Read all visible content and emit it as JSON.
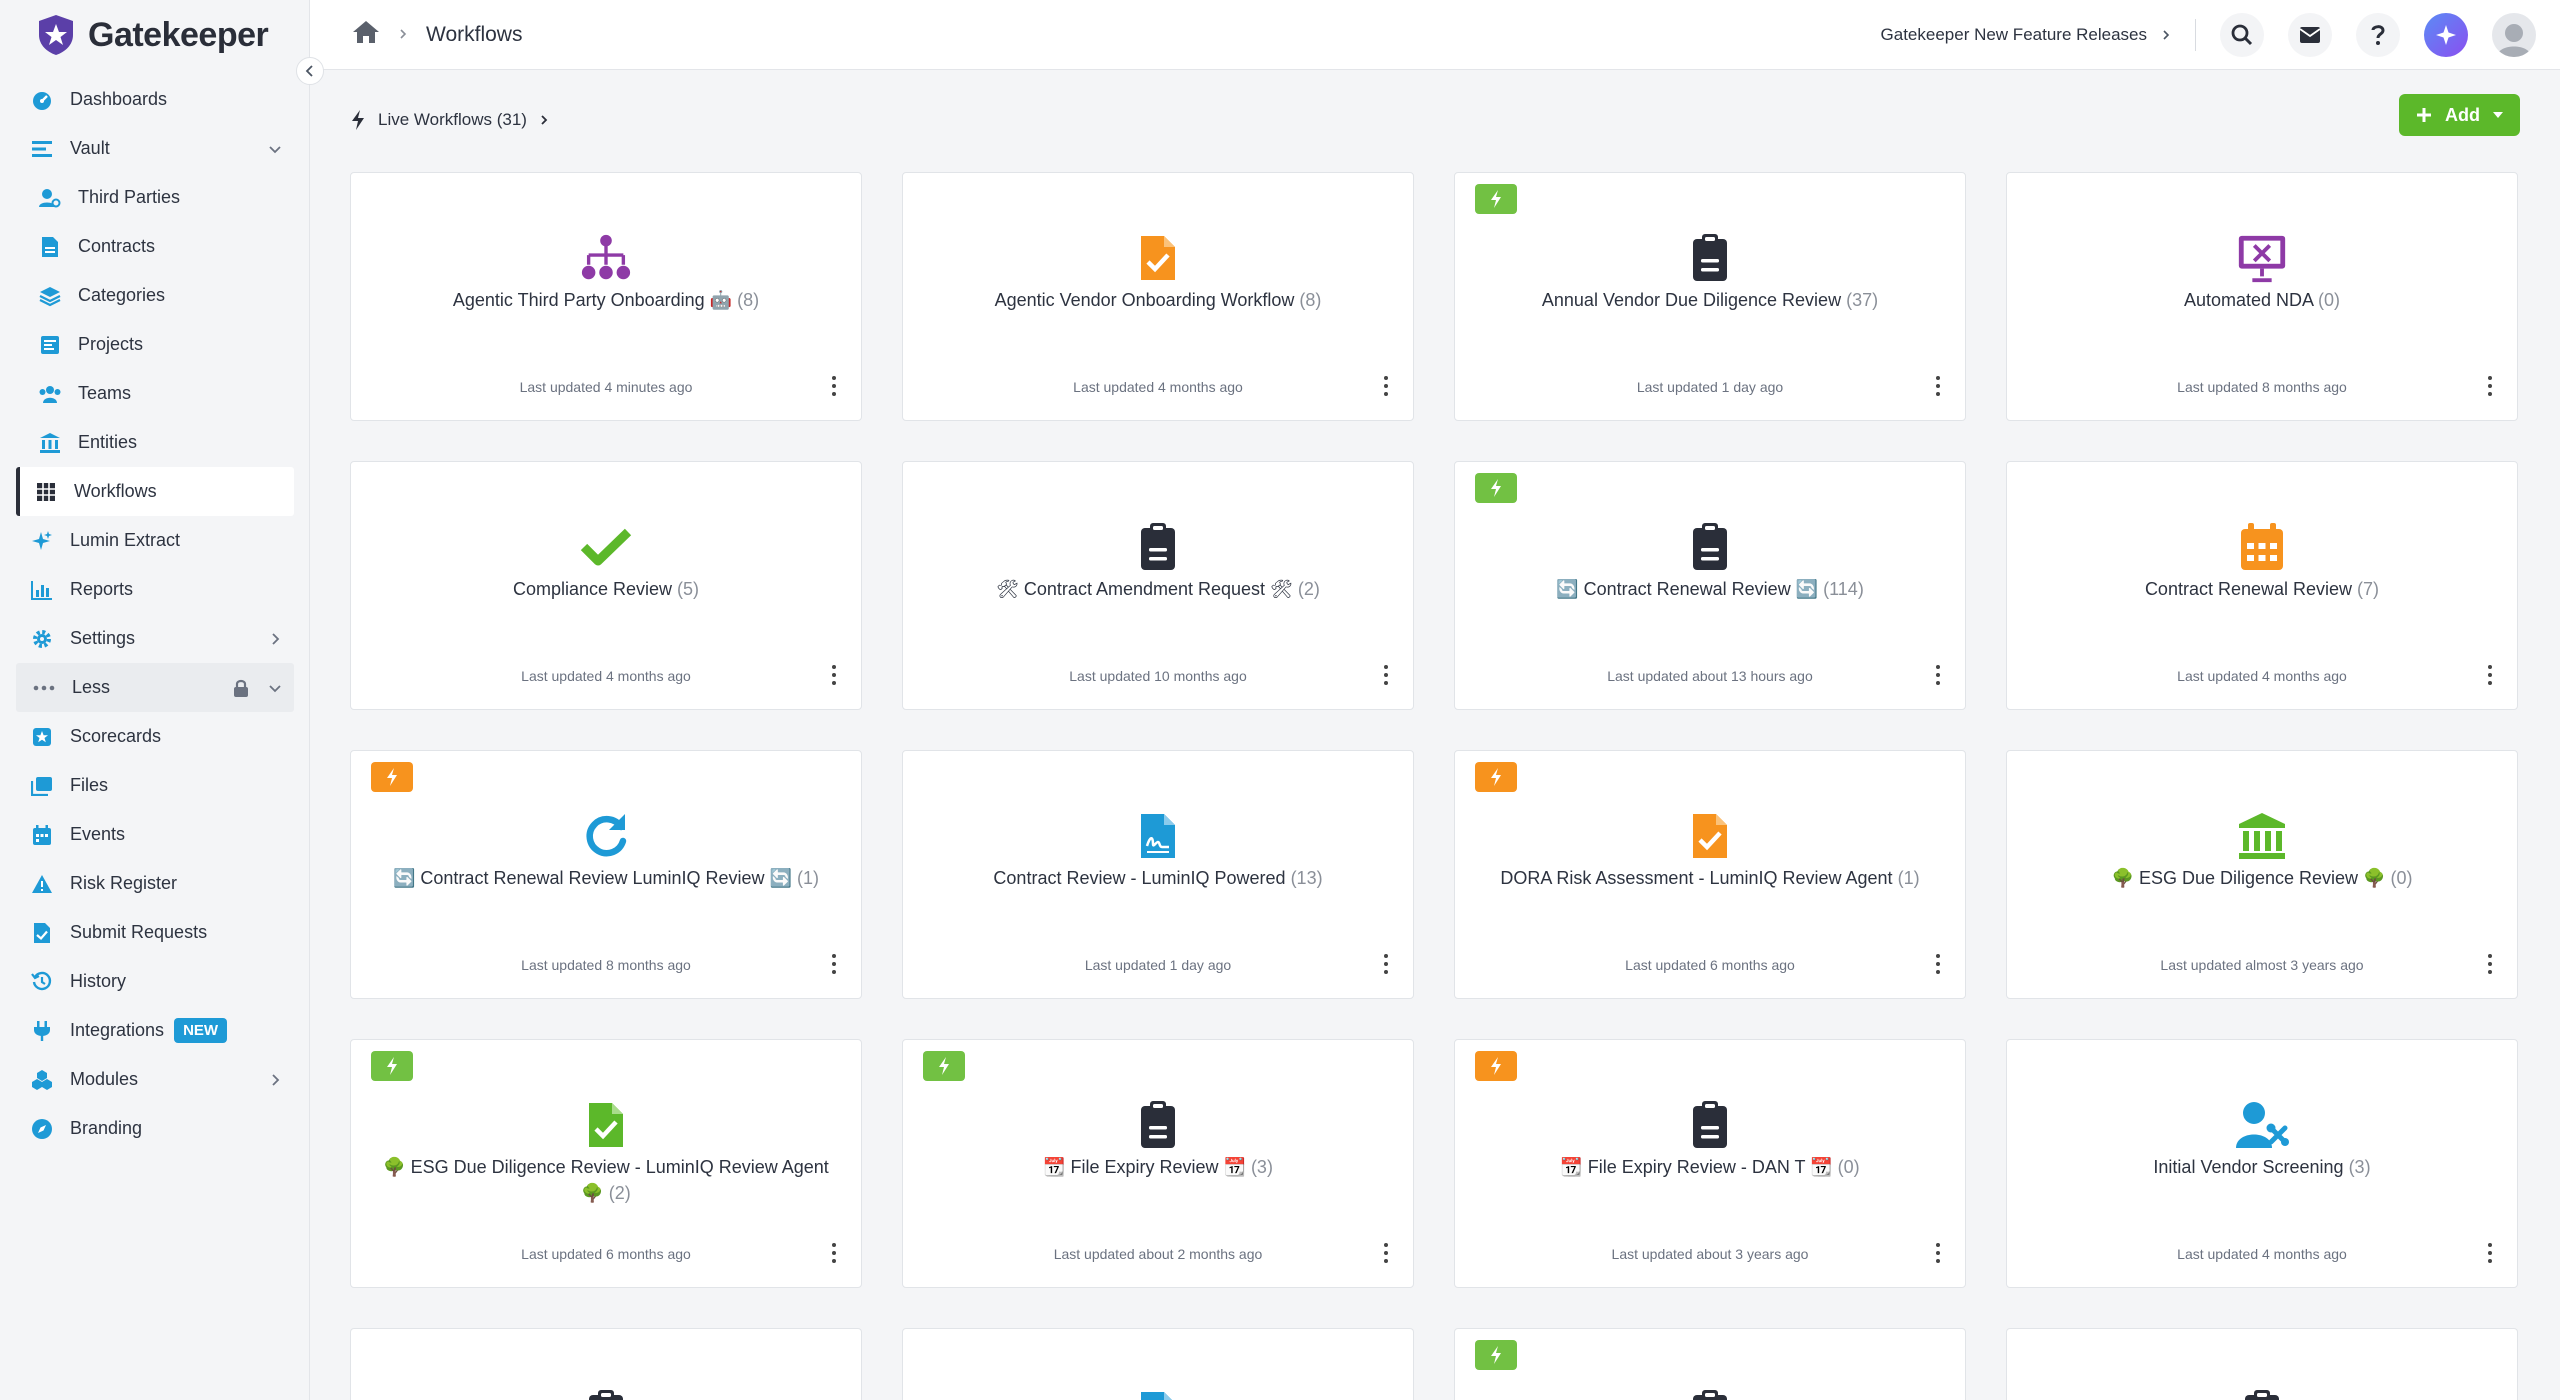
{
  "app": {
    "name": "Gatekeeper"
  },
  "sidebar": {
    "items": [
      {
        "key": "dashboards",
        "label": "Dashboards"
      },
      {
        "key": "vault",
        "label": "Vault"
      },
      {
        "key": "third-parties",
        "label": "Third Parties"
      },
      {
        "key": "contracts",
        "label": "Contracts"
      },
      {
        "key": "categories",
        "label": "Categories"
      },
      {
        "key": "projects",
        "label": "Projects"
      },
      {
        "key": "teams",
        "label": "Teams"
      },
      {
        "key": "entities",
        "label": "Entities"
      },
      {
        "key": "workflows",
        "label": "Workflows"
      },
      {
        "key": "lumin-extract",
        "label": "Lumin Extract"
      },
      {
        "key": "reports",
        "label": "Reports"
      },
      {
        "key": "settings",
        "label": "Settings"
      },
      {
        "key": "less",
        "label": "Less"
      },
      {
        "key": "scorecards",
        "label": "Scorecards"
      },
      {
        "key": "files",
        "label": "Files"
      },
      {
        "key": "events",
        "label": "Events"
      },
      {
        "key": "risk-register",
        "label": "Risk Register"
      },
      {
        "key": "submit-requests",
        "label": "Submit Requests"
      },
      {
        "key": "history",
        "label": "History"
      },
      {
        "key": "integrations",
        "label": "Integrations",
        "badge": "NEW"
      },
      {
        "key": "modules",
        "label": "Modules"
      },
      {
        "key": "branding",
        "label": "Branding"
      }
    ]
  },
  "header": {
    "breadcrumb_current": "Workflows",
    "release_link": "Gatekeeper New Feature Releases"
  },
  "toolbar": {
    "live_workflows": "Live Workflows (31)",
    "add_label": "Add"
  },
  "colors": {
    "accent_green": "#5cb82a",
    "flag_green": "#72c143",
    "flag_orange": "#f7931e",
    "brand_purple": "#5b3fa8",
    "icon_blue": "#1e9ad6"
  },
  "workflows": [
    {
      "title": "Agentic Third Party Onboarding  🤖",
      "count": "(8)",
      "updated": "Last updated 4 minutes ago",
      "icon": "org-chart-icon",
      "flag": null
    },
    {
      "title": "Agentic Vendor Onboarding Workflow",
      "count": "(8)",
      "updated": "Last updated 4 months ago",
      "icon": "file-check-icon",
      "flag": null
    },
    {
      "title": "Annual Vendor Due Diligence Review",
      "count": "(37)",
      "updated": "Last updated 1 day ago",
      "icon": "clipboard-icon",
      "flag": "green"
    },
    {
      "title": "Automated NDA",
      "count": "(0)",
      "updated": "Last updated 8 months ago",
      "icon": "presentation-tools-icon",
      "flag": null
    },
    {
      "title": "Compliance Review",
      "count": "(5)",
      "updated": "Last updated 4 months ago",
      "icon": "checkmark-icon",
      "flag": null
    },
    {
      "title": "🛠 Contract Amendment Request 🛠",
      "count": "(2)",
      "updated": "Last updated 10 months ago",
      "icon": "clipboard-icon",
      "flag": null
    },
    {
      "title": "🔄 Contract Renewal Review 🔄",
      "count": "(114)",
      "updated": "Last updated about 13 hours ago",
      "icon": "clipboard-icon",
      "flag": "green"
    },
    {
      "title": "Contract Renewal Review",
      "count": "(7)",
      "updated": "Last updated 4 months ago",
      "icon": "calendar-icon",
      "flag": null
    },
    {
      "title": "🔄 Contract Renewal Review LuminIQ Review 🔄",
      "count": "(1)",
      "updated": "Last updated 8 months ago",
      "icon": "refresh-icon",
      "flag": "orange"
    },
    {
      "title": "Contract Review - LuminIQ Powered",
      "count": "(13)",
      "updated": "Last updated 1 day ago",
      "icon": "file-signature-icon",
      "flag": null
    },
    {
      "title": "DORA Risk Assessment - LuminIQ Review Agent",
      "count": "(1)",
      "updated": "Last updated 6 months ago",
      "icon": "file-check-icon",
      "flag": "orange"
    },
    {
      "title": "🌳 ESG Due Diligence Review 🌳",
      "count": "(0)",
      "updated": "Last updated almost 3 years ago",
      "icon": "bank-icon",
      "flag": null
    },
    {
      "title": "🌳 ESG Due Diligence Review - LuminIQ Review Agent 🌳",
      "count": "(2)",
      "updated": "Last updated 6 months ago",
      "icon": "file-check-icon",
      "flag": "green"
    },
    {
      "title": "📆 File Expiry Review 📆",
      "count": "(3)",
      "updated": "Last updated about 2 months ago",
      "icon": "clipboard-icon",
      "flag": "green"
    },
    {
      "title": "📆 File Expiry Review - DAN T 📆",
      "count": "(0)",
      "updated": "Last updated about 3 years ago",
      "icon": "clipboard-icon",
      "flag": "orange"
    },
    {
      "title": "Initial Vendor Screening",
      "count": "(3)",
      "updated": "Last updated 4 months ago",
      "icon": "user-gear-icon",
      "flag": null
    }
  ],
  "partial_row": [
    {
      "icon": "clipboard-icon",
      "flag": null
    },
    {
      "icon": "file-signature-icon",
      "flag": null
    },
    {
      "icon": "clipboard-icon",
      "flag": "green"
    },
    {
      "icon": "clipboard-icon",
      "flag": null
    }
  ]
}
